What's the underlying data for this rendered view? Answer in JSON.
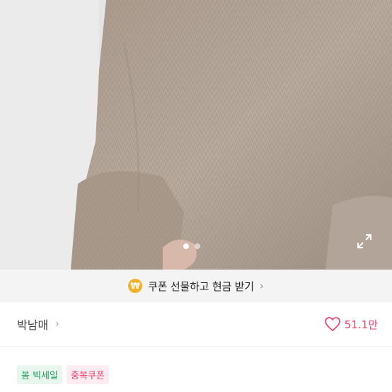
{
  "hero": {
    "image_alt": "product-photo-knit-sweater",
    "dots_total": 2,
    "dots_active": 1,
    "expand_icon": "expand-icon"
  },
  "coupon_bar": {
    "icon": "won-coin-icon",
    "icon_glyph": "₩",
    "text": "쿠폰 선물하고 현금 받기",
    "chevron": "›"
  },
  "seller": {
    "name": "박남매",
    "chevron": "›"
  },
  "like": {
    "icon": "heart-icon",
    "count": "51.1만"
  },
  "tags": [
    {
      "label": "봄 빅세일",
      "style": "green"
    },
    {
      "label": "중복쿠폰",
      "style": "pink"
    }
  ],
  "colors": {
    "accent_pink": "#ef3b6a",
    "coin_yellow": "#f2b32b",
    "tag_green": "#1e9f5c"
  }
}
